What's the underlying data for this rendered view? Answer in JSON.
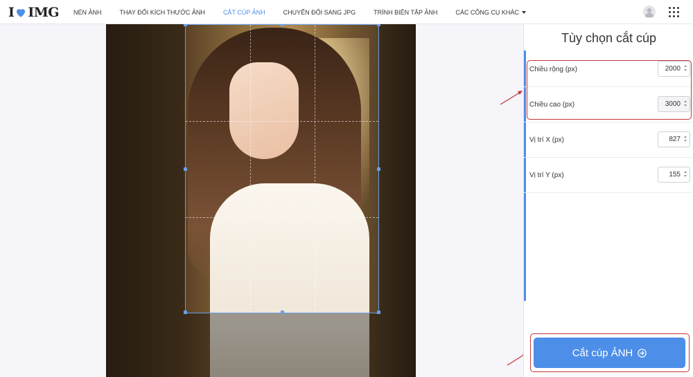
{
  "header": {
    "logo_left": "I",
    "logo_right": "IMG",
    "nav": [
      {
        "label": "NÉN ẢNH"
      },
      {
        "label": "THAY ĐỔI KÍCH THƯỚC ẢNH"
      },
      {
        "label": "CẮT CÚP ẢNH"
      },
      {
        "label": "CHUYỂN ĐỔI SANG JPG"
      },
      {
        "label": "TRÌNH BIÊN TẬP ẢNH"
      },
      {
        "label": "CÁC CÔNG CỤ KHÁC"
      }
    ],
    "active_index": 2
  },
  "sidebar": {
    "title": "Tùy chọn cắt cúp",
    "options": [
      {
        "label": "Chiều rộng (px)",
        "value": "2000"
      },
      {
        "label": "Chiều cao (px)",
        "value": "3000"
      },
      {
        "label": "Vị trí X (px)",
        "value": "827"
      },
      {
        "label": "Vị trí Y (px)",
        "value": "155"
      }
    ],
    "crop_button": "Cắt cúp ẢNH"
  },
  "colors": {
    "accent": "#4d8ee8",
    "annotation": "#c23636"
  },
  "icons": {
    "logo": "heart-icon",
    "avatar": "user-avatar-icon",
    "apps": "grid-menu-icon",
    "button": "arrow-right-circle-icon"
  }
}
